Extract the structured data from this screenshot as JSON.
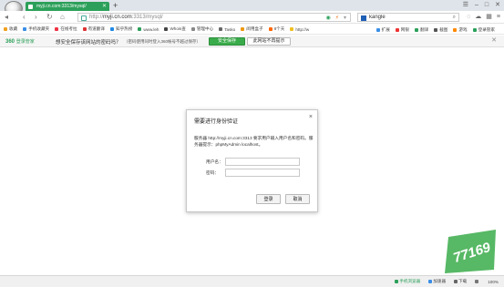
{
  "tab": {
    "title": "myji.cn.com:3313/mysql/"
  },
  "window": {
    "new_tab_label": "+",
    "controls": [
      "☰",
      "–",
      "□",
      "✕"
    ]
  },
  "nav": {
    "url_prefix": "http://",
    "url_host": "myji.cn.com",
    "url_rest": ":3313/mysql/",
    "search_value": "kangle"
  },
  "bookmarks": [
    {
      "label": "收藏",
      "color": "#f0a020"
    },
    {
      "label": "手机收藏夹",
      "color": "#3a8ee6"
    },
    {
      "label": "在线考拉",
      "color": "#e34"
    },
    {
      "label": "有道翻译",
      "color": "#d33"
    },
    {
      "label": "知乎热榜",
      "color": "#1e88e5"
    },
    {
      "label": "www.leh",
      "color": "#2ca05a"
    },
    {
      "label": "Whois查",
      "color": "#444"
    },
    {
      "label": "管理中心",
      "color": "#888"
    },
    {
      "label": "Tasko",
      "color": "#666"
    },
    {
      "label": "阅用盒子",
      "color": "#e91"
    },
    {
      "label": "8个天",
      "color": "#f60"
    },
    {
      "label": "http://w",
      "color": "#f0c020"
    }
  ],
  "bookmarks_right": [
    {
      "label": "扩展",
      "color": "#3a8ee6"
    },
    {
      "label": "网银",
      "color": "#e33"
    },
    {
      "label": "翻译",
      "color": "#2ca05a"
    },
    {
      "label": "截图",
      "color": "#555"
    },
    {
      "label": "游戏",
      "color": "#f80"
    },
    {
      "label": "登录管家",
      "color": "#2ca05a"
    }
  ],
  "password_bar": {
    "logo": "360",
    "logo_sub": "登录管家",
    "message": "想安全保存该网站的密码吗？",
    "note": "（密码使用同时登入360帐号不越过保存）",
    "save_label": "安全保存",
    "never_label": "此网站不再提示",
    "close": "✕"
  },
  "dialog": {
    "title": "需要进行身份验证",
    "close": "×",
    "text": "服务器 http://myji.cn.com:3313 要求用户输入用户名和密码。服务器提示：phpMyAdmin localhost。",
    "username_label": "用户名：",
    "password_label": "密码：",
    "login_label": "登录",
    "cancel_label": "取消"
  },
  "status": {
    "items": [
      "手机浏览器",
      "加速器",
      "下载",
      "",
      "100%"
    ]
  },
  "watermark": {
    "text": "77169",
    "color": "#3aab4a"
  }
}
